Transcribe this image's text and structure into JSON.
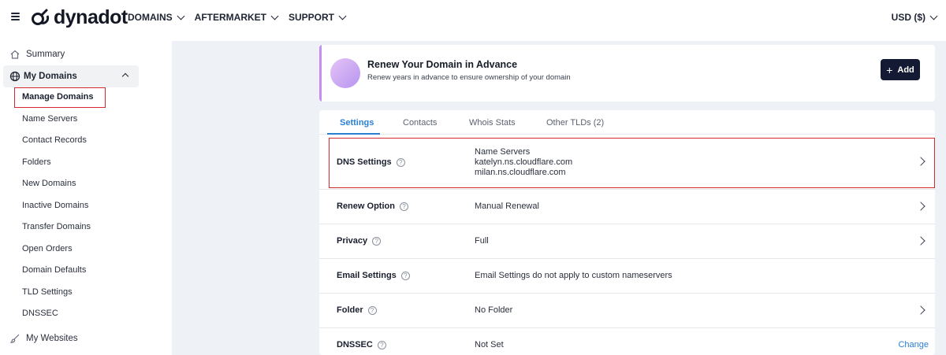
{
  "header": {
    "logo_text": "dynadot",
    "nav": [
      "DOMAINS",
      "AFTERMARKET",
      "SUPPORT"
    ],
    "currency": "USD ($)"
  },
  "sidebar": {
    "summary": "Summary",
    "my_domains": "My Domains",
    "sub_items": [
      "Manage Domains",
      "Name Servers",
      "Contact Records",
      "Folders",
      "New Domains",
      "Inactive Domains",
      "Transfer Domains",
      "Open Orders",
      "Domain Defaults",
      "TLD Settings",
      "DNSSEC"
    ],
    "my_websites": "My Websites"
  },
  "banner": {
    "title": "Renew Your Domain in Advance",
    "subtitle": "Renew years in advance to ensure ownership of your domain",
    "add_label": "Add"
  },
  "tabs": [
    "Settings",
    "Contacts",
    "Whois Stats",
    "Other TLDs (2)"
  ],
  "settings": {
    "dns": {
      "label": "DNS Settings",
      "line1": "Name Servers",
      "line2": "katelyn.ns.cloudflare.com",
      "line3": "milan.ns.cloudflare.com"
    },
    "renew": {
      "label": "Renew Option",
      "value": "Manual Renewal"
    },
    "privacy": {
      "label": "Privacy",
      "value": "Full"
    },
    "email": {
      "label": "Email Settings",
      "value": "Email Settings do not apply to custom nameservers"
    },
    "folder": {
      "label": "Folder",
      "value": "No Folder"
    },
    "dnssec": {
      "label": "DNSSEC",
      "value": "Not Set",
      "action": "Change"
    }
  },
  "colors": {
    "accent": "#2a7fd4",
    "dark_button": "#141a33",
    "highlight": "#d42b33",
    "banner_stripe": "#c58cf2"
  }
}
